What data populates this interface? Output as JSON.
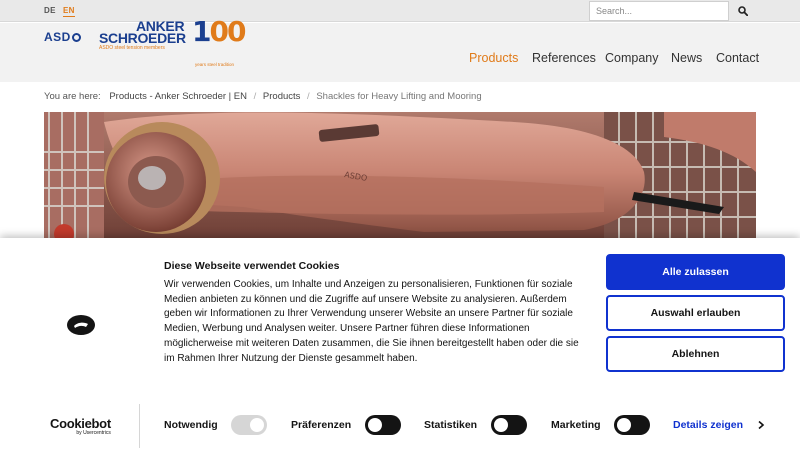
{
  "topbar": {
    "lang_de": "DE",
    "lang_en": "EN",
    "search_placeholder": "Search..."
  },
  "header": {
    "logo_asdo": "ASD",
    "logo_anker_line1": "ANKER",
    "logo_anker_line2": "SCHROEDER",
    "logo_anker_tagline": "ASDO steel tension members",
    "logo_100_digit": "1",
    "logo_100_zeros": "00",
    "logo_100_tagline": "years steel tradition",
    "nav": [
      {
        "label": "Products",
        "active": true
      },
      {
        "label": "References",
        "active": false
      },
      {
        "label": "Company",
        "active": false
      },
      {
        "label": "News",
        "active": false
      },
      {
        "label": "Contact",
        "active": false
      }
    ]
  },
  "breadcrumb": {
    "prefix": "You are here:",
    "items": [
      "Products - Anker Schroeder | EN",
      "Products",
      "Shackles for Heavy Lifting and Mooring"
    ],
    "sep": "/"
  },
  "hero": {
    "marking_text": "ASDO"
  },
  "cookie": {
    "title": "Diese Webseite verwendet Cookies",
    "body": "Wir verwenden Cookies, um Inhalte und Anzeigen zu personalisieren, Funktionen für soziale Medien anbieten zu können und die Zugriffe auf unsere Website zu analysieren. Außerdem geben wir Informationen zu Ihrer Verwendung unserer Website an unsere Partner für soziale Medien, Werbung und Analysen weiter. Unsere Partner führen diese Informationen möglicherweise mit weiteren Daten zusammen, die Sie ihnen bereitgestellt haben oder die sie im Rahmen Ihrer Nutzung der Dienste gesammelt haben.",
    "btn_allow_all": "Alle zulassen",
    "btn_allow_selection": "Auswahl erlauben",
    "btn_decline": "Ablehnen",
    "brand": "Cookiebot",
    "brand_by": "by Usercentrics",
    "toggles": [
      {
        "label": "Notwendig",
        "checked": true
      },
      {
        "label": "Präferenzen",
        "checked": false
      },
      {
        "label": "Statistiken",
        "checked": false
      },
      {
        "label": "Marketing",
        "checked": false
      }
    ],
    "details_label": "Details zeigen"
  },
  "colors": {
    "accent_orange": "#e07b1a",
    "brand_blue": "#1b3f8f",
    "cookie_blue": "#1032cf"
  }
}
